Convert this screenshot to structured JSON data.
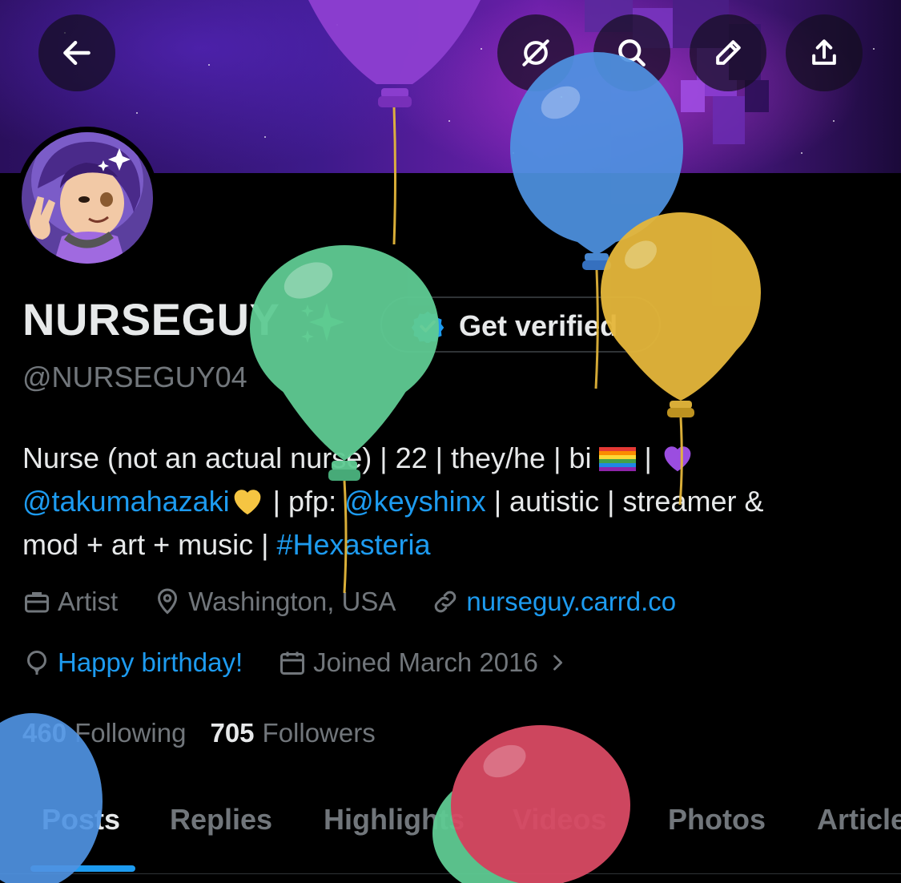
{
  "profile": {
    "display_name": "NURSEGUY",
    "handle": "@NURSEGUY04",
    "verify_label": "Get verified",
    "bio": {
      "line1_text": "Nurse (not an actual nurse) | 22 | they/he | bi ",
      "line1_sep": " | ",
      "line2_mention1": "@takumahazaki",
      "line2_text1": " | pfp: ",
      "line2_mention2": "@keyshinx",
      "line2_text2": " | autistic | streamer &",
      "line3_text": "mod + art + music | ",
      "line3_hashtag": "#Hexasteria"
    },
    "meta": {
      "category": "Artist",
      "location": "Washington, USA",
      "website": "nurseguy.carrd.co",
      "birthday": "Happy birthday!",
      "joined": "Joined March 2016"
    },
    "stats": {
      "following_count": "460",
      "following_label": "Following",
      "followers_count": "705",
      "followers_label": "Followers"
    }
  },
  "tabs": [
    {
      "label": "Posts",
      "active": true
    },
    {
      "label": "Replies"
    },
    {
      "label": "Highlights"
    },
    {
      "label": "Videos"
    },
    {
      "label": "Photos"
    },
    {
      "label": "Articles"
    }
  ],
  "header_icons": [
    "back-arrow-icon",
    "grok-icon",
    "search-icon",
    "pencil-icon",
    "share-icon"
  ],
  "colors": {
    "accent": "#1d9bf0",
    "muted": "#71767b",
    "text": "#e7e9ea",
    "balloon_blue": "#4f93e2",
    "balloon_green": "#5fcb93",
    "balloon_yellow": "#e5b73b",
    "balloon_red": "#d94a64",
    "balloon_purple": "#8e3fd1"
  }
}
